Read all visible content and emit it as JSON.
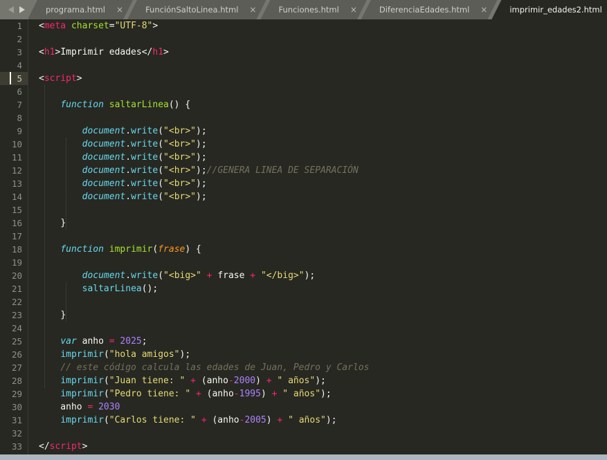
{
  "tabbar": {
    "nav_prev_icon": "triangle-left-icon",
    "nav_next_icon": "triangle-right-icon",
    "close_glyph": "×",
    "tabs": [
      {
        "label": "programa.html",
        "active": false,
        "closable": true
      },
      {
        "label": "FunciónSaltoLinea.html",
        "active": false,
        "closable": true
      },
      {
        "label": "Funciones.html",
        "active": false,
        "closable": true
      },
      {
        "label": "DiferenciaEdades.html",
        "active": false,
        "closable": true
      },
      {
        "label": "imprimir_edades2.html",
        "active": true,
        "closable": false
      }
    ]
  },
  "editor": {
    "current_line": 5,
    "line_numbers": [
      1,
      2,
      3,
      4,
      5,
      6,
      7,
      8,
      9,
      10,
      11,
      12,
      13,
      14,
      15,
      16,
      17,
      18,
      19,
      20,
      21,
      22,
      23,
      24,
      25,
      26,
      27,
      28,
      29,
      30,
      31,
      32,
      33
    ],
    "lines": [
      {
        "n": 1,
        "tokens": [
          {
            "c": "t-punct",
            "v": "<"
          },
          {
            "c": "t-tag",
            "v": "meta"
          },
          {
            "c": "t-plain",
            "v": " "
          },
          {
            "c": "t-attr",
            "v": "charset"
          },
          {
            "c": "t-punct",
            "v": "="
          },
          {
            "c": "t-str",
            "v": "\"UTF-8\""
          },
          {
            "c": "t-punct",
            "v": ">"
          }
        ]
      },
      {
        "n": 2,
        "tokens": []
      },
      {
        "n": 3,
        "tokens": [
          {
            "c": "t-punct",
            "v": "<"
          },
          {
            "c": "t-tag",
            "v": "h1"
          },
          {
            "c": "t-punct",
            "v": ">"
          },
          {
            "c": "t-plain",
            "v": "Imprimir edades"
          },
          {
            "c": "t-punct",
            "v": "</"
          },
          {
            "c": "t-tag",
            "v": "h1"
          },
          {
            "c": "t-punct",
            "v": ">"
          }
        ]
      },
      {
        "n": 4,
        "tokens": []
      },
      {
        "n": 5,
        "tokens": [
          {
            "c": "t-punct",
            "v": "<"
          },
          {
            "c": "t-tag",
            "v": "script"
          },
          {
            "c": "t-punct",
            "v": ">"
          }
        ]
      },
      {
        "n": 6,
        "tokens": []
      },
      {
        "n": 7,
        "tokens": [
          {
            "c": "t-plain",
            "v": "    "
          },
          {
            "c": "t-kw",
            "v": "function"
          },
          {
            "c": "t-plain",
            "v": " "
          },
          {
            "c": "t-fname",
            "v": "saltarLinea"
          },
          {
            "c": "t-punct",
            "v": "() {"
          }
        ]
      },
      {
        "n": 8,
        "tokens": []
      },
      {
        "n": 9,
        "tokens": [
          {
            "c": "t-plain",
            "v": "        "
          },
          {
            "c": "t-var",
            "v": "document"
          },
          {
            "c": "t-punct",
            "v": "."
          },
          {
            "c": "t-prop",
            "v": "write"
          },
          {
            "c": "t-punct",
            "v": "("
          },
          {
            "c": "t-str",
            "v": "\"<br>\""
          },
          {
            "c": "t-punct",
            "v": ");"
          }
        ]
      },
      {
        "n": 10,
        "tokens": [
          {
            "c": "t-plain",
            "v": "        "
          },
          {
            "c": "t-var",
            "v": "document"
          },
          {
            "c": "t-punct",
            "v": "."
          },
          {
            "c": "t-prop",
            "v": "write"
          },
          {
            "c": "t-punct",
            "v": "("
          },
          {
            "c": "t-str",
            "v": "\"<br>\""
          },
          {
            "c": "t-punct",
            "v": ");"
          }
        ]
      },
      {
        "n": 11,
        "tokens": [
          {
            "c": "t-plain",
            "v": "        "
          },
          {
            "c": "t-var",
            "v": "document"
          },
          {
            "c": "t-punct",
            "v": "."
          },
          {
            "c": "t-prop",
            "v": "write"
          },
          {
            "c": "t-punct",
            "v": "("
          },
          {
            "c": "t-str",
            "v": "\"<br>\""
          },
          {
            "c": "t-punct",
            "v": ");"
          }
        ]
      },
      {
        "n": 12,
        "tokens": [
          {
            "c": "t-plain",
            "v": "        "
          },
          {
            "c": "t-var",
            "v": "document"
          },
          {
            "c": "t-punct",
            "v": "."
          },
          {
            "c": "t-prop",
            "v": "write"
          },
          {
            "c": "t-punct",
            "v": "("
          },
          {
            "c": "t-str",
            "v": "\"<hr>\""
          },
          {
            "c": "t-punct",
            "v": ");"
          },
          {
            "c": "t-comment",
            "v": "//GENERA LINEA DE SEPARACIÓN"
          }
        ]
      },
      {
        "n": 13,
        "tokens": [
          {
            "c": "t-plain",
            "v": "        "
          },
          {
            "c": "t-var",
            "v": "document"
          },
          {
            "c": "t-punct",
            "v": "."
          },
          {
            "c": "t-prop",
            "v": "write"
          },
          {
            "c": "t-punct",
            "v": "("
          },
          {
            "c": "t-str",
            "v": "\"<br>\""
          },
          {
            "c": "t-punct",
            "v": ");"
          }
        ]
      },
      {
        "n": 14,
        "tokens": [
          {
            "c": "t-plain",
            "v": "        "
          },
          {
            "c": "t-var",
            "v": "document"
          },
          {
            "c": "t-punct",
            "v": "."
          },
          {
            "c": "t-prop",
            "v": "write"
          },
          {
            "c": "t-punct",
            "v": "("
          },
          {
            "c": "t-str",
            "v": "\"<br>\""
          },
          {
            "c": "t-punct",
            "v": ");"
          }
        ]
      },
      {
        "n": 15,
        "tokens": []
      },
      {
        "n": 16,
        "tokens": [
          {
            "c": "t-plain",
            "v": "    "
          },
          {
            "c": "t-punct",
            "v": "}"
          }
        ]
      },
      {
        "n": 17,
        "tokens": []
      },
      {
        "n": 18,
        "tokens": [
          {
            "c": "t-plain",
            "v": "    "
          },
          {
            "c": "t-kw",
            "v": "function"
          },
          {
            "c": "t-plain",
            "v": " "
          },
          {
            "c": "t-fname",
            "v": "imprimir"
          },
          {
            "c": "t-punct",
            "v": "("
          },
          {
            "c": "t-param",
            "v": "frase"
          },
          {
            "c": "t-punct",
            "v": ") {"
          }
        ]
      },
      {
        "n": 19,
        "tokens": []
      },
      {
        "n": 20,
        "tokens": [
          {
            "c": "t-plain",
            "v": "        "
          },
          {
            "c": "t-var",
            "v": "document"
          },
          {
            "c": "t-punct",
            "v": "."
          },
          {
            "c": "t-prop",
            "v": "write"
          },
          {
            "c": "t-punct",
            "v": "("
          },
          {
            "c": "t-str",
            "v": "\"<big>\""
          },
          {
            "c": "t-plain",
            "v": " "
          },
          {
            "c": "t-op",
            "v": "+"
          },
          {
            "c": "t-plain",
            "v": " frase "
          },
          {
            "c": "t-op",
            "v": "+"
          },
          {
            "c": "t-plain",
            "v": " "
          },
          {
            "c": "t-str",
            "v": "\"</big>\""
          },
          {
            "c": "t-punct",
            "v": ");"
          }
        ]
      },
      {
        "n": 21,
        "tokens": [
          {
            "c": "t-plain",
            "v": "        "
          },
          {
            "c": "t-call",
            "v": "saltarLinea"
          },
          {
            "c": "t-punct",
            "v": "();"
          }
        ]
      },
      {
        "n": 22,
        "tokens": []
      },
      {
        "n": 23,
        "tokens": [
          {
            "c": "t-plain",
            "v": "    "
          },
          {
            "c": "t-punct",
            "v": "}"
          }
        ]
      },
      {
        "n": 24,
        "tokens": []
      },
      {
        "n": 25,
        "tokens": [
          {
            "c": "t-plain",
            "v": "    "
          },
          {
            "c": "t-kw",
            "v": "var"
          },
          {
            "c": "t-plain",
            "v": " anho "
          },
          {
            "c": "t-op",
            "v": "="
          },
          {
            "c": "t-plain",
            "v": " "
          },
          {
            "c": "t-num",
            "v": "2025"
          },
          {
            "c": "t-punct",
            "v": ";"
          }
        ]
      },
      {
        "n": 26,
        "tokens": [
          {
            "c": "t-plain",
            "v": "    "
          },
          {
            "c": "t-call",
            "v": "imprimir"
          },
          {
            "c": "t-punct",
            "v": "("
          },
          {
            "c": "t-str",
            "v": "\"hola amigos\""
          },
          {
            "c": "t-punct",
            "v": ");"
          }
        ]
      },
      {
        "n": 27,
        "tokens": [
          {
            "c": "t-plain",
            "v": "    "
          },
          {
            "c": "t-comment",
            "v": "// este código calcula las edades de Juan, Pedro y Carlos"
          }
        ]
      },
      {
        "n": 28,
        "tokens": [
          {
            "c": "t-plain",
            "v": "    "
          },
          {
            "c": "t-call",
            "v": "imprimir"
          },
          {
            "c": "t-punct",
            "v": "("
          },
          {
            "c": "t-str",
            "v": "\"Juan tiene: \""
          },
          {
            "c": "t-plain",
            "v": " "
          },
          {
            "c": "t-op",
            "v": "+"
          },
          {
            "c": "t-plain",
            "v": " (anho"
          },
          {
            "c": "t-op",
            "v": "-"
          },
          {
            "c": "t-num",
            "v": "2000"
          },
          {
            "c": "t-plain",
            "v": ") "
          },
          {
            "c": "t-op",
            "v": "+"
          },
          {
            "c": "t-plain",
            "v": " "
          },
          {
            "c": "t-str",
            "v": "\" años\""
          },
          {
            "c": "t-punct",
            "v": ");"
          }
        ]
      },
      {
        "n": 29,
        "tokens": [
          {
            "c": "t-plain",
            "v": "    "
          },
          {
            "c": "t-call",
            "v": "imprimir"
          },
          {
            "c": "t-punct",
            "v": "("
          },
          {
            "c": "t-str",
            "v": "\"Pedro tiene: \""
          },
          {
            "c": "t-plain",
            "v": " "
          },
          {
            "c": "t-op",
            "v": "+"
          },
          {
            "c": "t-plain",
            "v": " (anho"
          },
          {
            "c": "t-op",
            "v": "-"
          },
          {
            "c": "t-num",
            "v": "1995"
          },
          {
            "c": "t-plain",
            "v": ") "
          },
          {
            "c": "t-op",
            "v": "+"
          },
          {
            "c": "t-plain",
            "v": " "
          },
          {
            "c": "t-str",
            "v": "\" años\""
          },
          {
            "c": "t-punct",
            "v": ");"
          }
        ]
      },
      {
        "n": 30,
        "tokens": [
          {
            "c": "t-plain",
            "v": "    anho "
          },
          {
            "c": "t-op",
            "v": "="
          },
          {
            "c": "t-plain",
            "v": " "
          },
          {
            "c": "t-num",
            "v": "2030"
          }
        ]
      },
      {
        "n": 31,
        "tokens": [
          {
            "c": "t-plain",
            "v": "    "
          },
          {
            "c": "t-call",
            "v": "imprimir"
          },
          {
            "c": "t-punct",
            "v": "("
          },
          {
            "c": "t-str",
            "v": "\"Carlos tiene: \""
          },
          {
            "c": "t-plain",
            "v": " "
          },
          {
            "c": "t-op",
            "v": "+"
          },
          {
            "c": "t-plain",
            "v": " (anho"
          },
          {
            "c": "t-op",
            "v": "-"
          },
          {
            "c": "t-num",
            "v": "2005"
          },
          {
            "c": "t-plain",
            "v": ") "
          },
          {
            "c": "t-op",
            "v": "+"
          },
          {
            "c": "t-plain",
            "v": " "
          },
          {
            "c": "t-str",
            "v": "\" años\""
          },
          {
            "c": "t-punct",
            "v": ");"
          }
        ]
      },
      {
        "n": 32,
        "tokens": []
      },
      {
        "n": 33,
        "tokens": [
          {
            "c": "t-punct",
            "v": "</"
          },
          {
            "c": "t-tag",
            "v": "script"
          },
          {
            "c": "t-punct",
            "v": ">"
          }
        ]
      }
    ]
  },
  "colors": {
    "editor_bg": "#272822",
    "tabbar_bg": "#75766e",
    "tab_inactive_bg": "#5c5d57",
    "current_line_gutter": "#3e3d32",
    "statusbar_bg": "#aeb6bf",
    "tag": "#f92672",
    "string": "#e6db74",
    "attribute": "#a6e22e",
    "keyword": "#66d9ef",
    "number": "#ae81ff",
    "comment": "#75715e",
    "parameter": "#fd971f",
    "text": "#f8f8f2"
  }
}
